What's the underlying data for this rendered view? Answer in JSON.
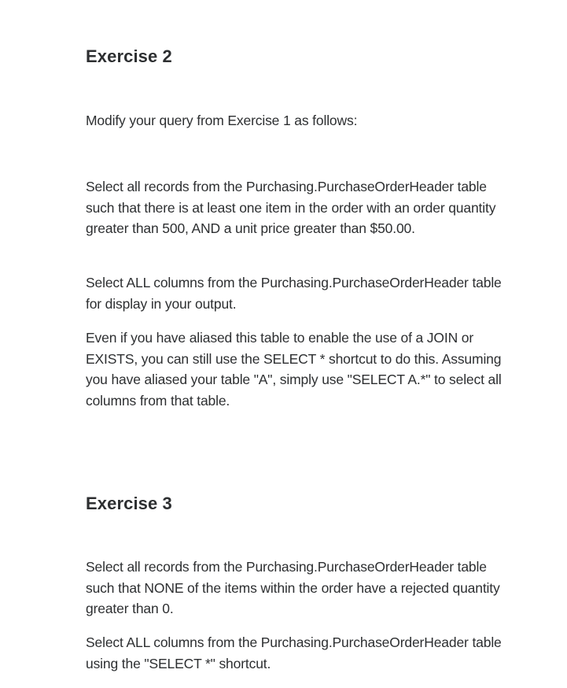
{
  "exercise2": {
    "title": "Exercise 2",
    "intro": "Modify your query from Exercise 1 as follows:",
    "paragraphs": [
      "Select all records from the Purchasing.PurchaseOrderHeader table such that there is at least one item in the order with an order quantity greater than 500, AND a unit price greater than $50.00.",
      "Select ALL columns from the Purchasing.PurchaseOrderHeader table for display in your output.",
      "Even if you have aliased this table to enable the use of a JOIN or EXISTS, you can still use the SELECT * shortcut to do this. Assuming you have aliased your table \"A\", simply use \"SELECT A.*\" to select all columns from that table."
    ]
  },
  "exercise3": {
    "title": "Exercise 3",
    "paragraphs": [
      "Select all records from the Purchasing.PurchaseOrderHeader table such that NONE of the items within the order have a rejected quantity greater than 0.",
      "Select ALL columns from the Purchasing.PurchaseOrderHeader table using the \"SELECT *\" shortcut."
    ]
  }
}
